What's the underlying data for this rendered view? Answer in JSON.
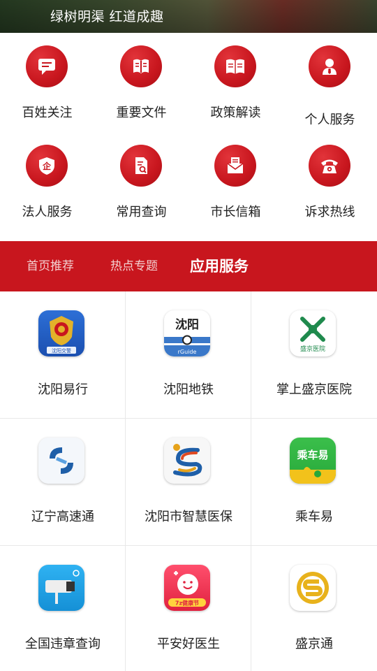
{
  "banner": {
    "caption": "绿树明渠 红道成趣"
  },
  "quick_services": [
    {
      "label": "百姓关注",
      "icon": "chat-bubble-icon"
    },
    {
      "label": "重要文件",
      "icon": "document-icon"
    },
    {
      "label": "政策解读",
      "icon": "open-book-icon"
    },
    {
      "label": "个人服务",
      "icon": "person-icon"
    },
    {
      "label": "法人服务",
      "icon": "enterprise-shield-icon"
    },
    {
      "label": "常用查询",
      "icon": "file-search-icon"
    },
    {
      "label": "市长信箱",
      "icon": "mailbox-icon"
    },
    {
      "label": "诉求热线",
      "icon": "telephone-icon"
    }
  ],
  "tabs": [
    {
      "label": "首页推荐",
      "active": false
    },
    {
      "label": "热点专题",
      "active": false
    },
    {
      "label": "应用服务",
      "active": true
    }
  ],
  "apps": [
    {
      "label": "沈阳易行",
      "icon": "police-emblem-icon",
      "icon_text": "沈阳交警"
    },
    {
      "label": "沈阳地铁",
      "icon": "metro-icon",
      "icon_text": "沈阳",
      "icon_subtext": "rGuide"
    },
    {
      "label": "掌上盛京医院",
      "icon": "hospital-logo-icon",
      "icon_text": "盛京医院"
    },
    {
      "label": "辽宁高速通",
      "icon": "highway-logo-icon"
    },
    {
      "label": "沈阳市智慧医保",
      "icon": "medical-insurance-logo-icon"
    },
    {
      "label": "乘车易",
      "icon": "bus-ride-icon",
      "icon_text": "乘车易"
    },
    {
      "label": "全国违章查询",
      "icon": "traffic-camera-icon"
    },
    {
      "label": "平安好医生",
      "icon": "doctor-smile-icon",
      "icon_text": "7z健康节"
    },
    {
      "label": "盛京通",
      "icon": "shengjing-card-icon"
    }
  ],
  "colors": {
    "brand_red": "#c8161e",
    "tab_inactive_text": "#f3d0d0"
  }
}
